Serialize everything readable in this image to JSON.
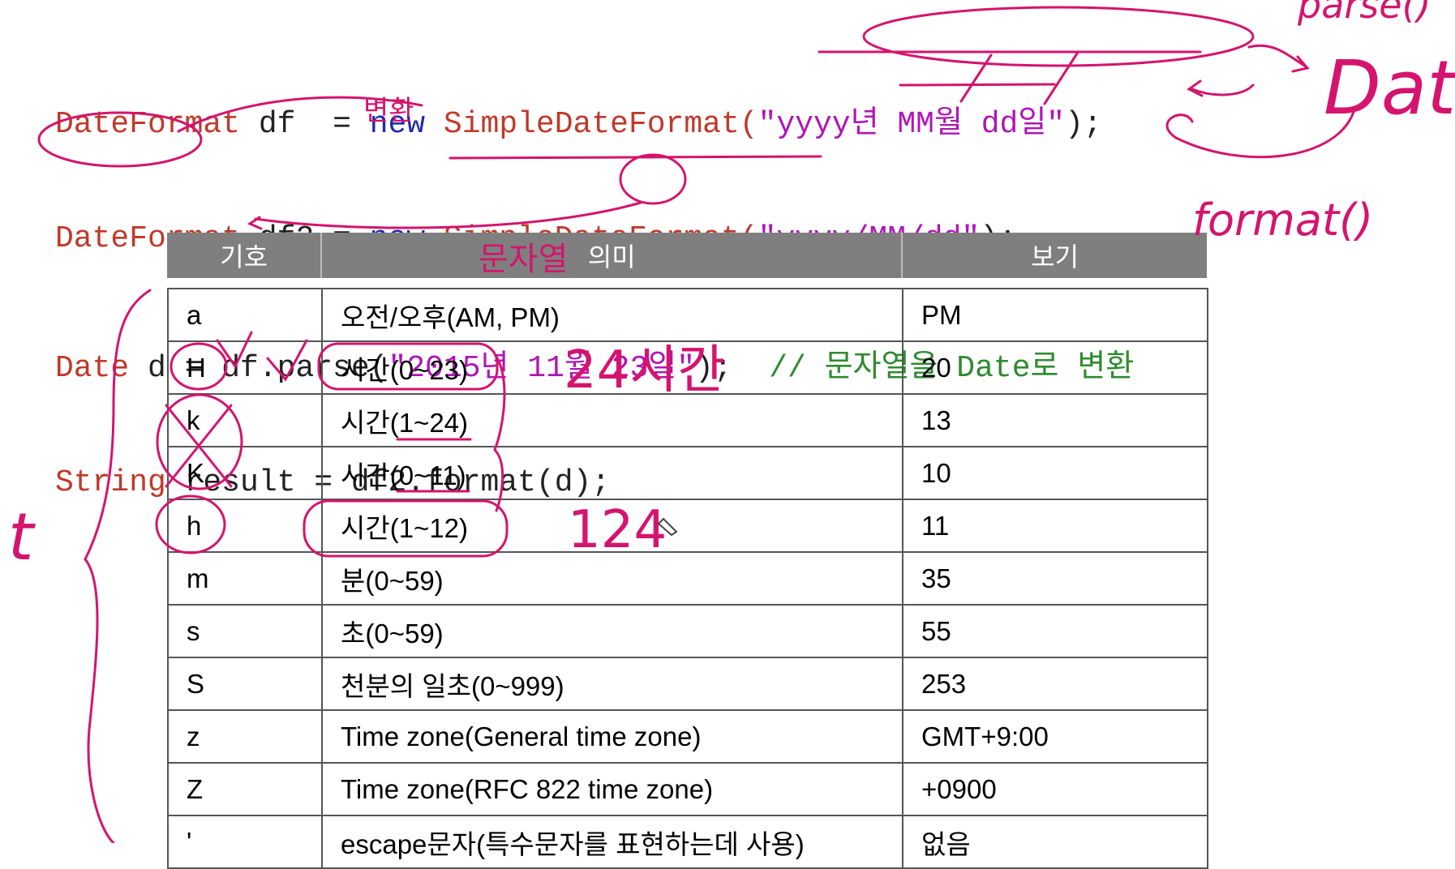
{
  "code": {
    "line1": {
      "type": "DateFormat",
      "rest": " df  = ",
      "new": "new",
      "cls": " SimpleDateFormat(",
      "str": "\"yyyy년 MM월 dd일\"",
      "end": ");"
    },
    "line2": {
      "type": "DateFormat",
      "rest": " df2 = ",
      "new": "new",
      "cls": " SimpleDateFormat(",
      "str": "\"yyyy/MM/dd\"",
      "end": ");"
    },
    "line3": {
      "type": "Date",
      "rest": " d = df.parse(",
      "str": "\"2015년 11월 23일\"",
      "end": ");  ",
      "comment": "// 문자열을 Date로 변환"
    },
    "line4": {
      "type": "String",
      "rest": " result = df2.format(d);"
    }
  },
  "table": {
    "headers": [
      "기호",
      "의미",
      "보기"
    ],
    "rows": [
      [
        "a",
        "오전/오후(AM, PM)",
        "PM"
      ],
      [
        "H",
        "시간(0~23)",
        "20"
      ],
      [
        "k",
        "시간(1~24)",
        "13"
      ],
      [
        "K",
        "시간(0~11)",
        "10"
      ],
      [
        "h",
        "시간(1~12)",
        "11"
      ],
      [
        "m",
        "분(0~59)",
        "35"
      ],
      [
        "s",
        "초(0~59)",
        "55"
      ],
      [
        "S",
        "천분의 일초(0~999)",
        "253"
      ],
      [
        "z",
        "Time zone(General time zone)",
        "GMT+9:00"
      ],
      [
        "Z",
        "Time zone(RFC 822 time zone)",
        "+0900"
      ],
      [
        "'",
        "escape문자(특수문자를 표현하는데 사용)",
        "없음"
      ]
    ]
  },
  "handwriting": {
    "date": "Date",
    "format": "format()",
    "parse": "parse()",
    "h24": "24시간",
    "h12": "124",
    "t": "t",
    "byeonhwan": "변환",
    "munjayeol": "문자열"
  },
  "colors": {
    "ink": "#d4146e",
    "header_bg": "#7f7f7f",
    "string": "#b014b8"
  }
}
